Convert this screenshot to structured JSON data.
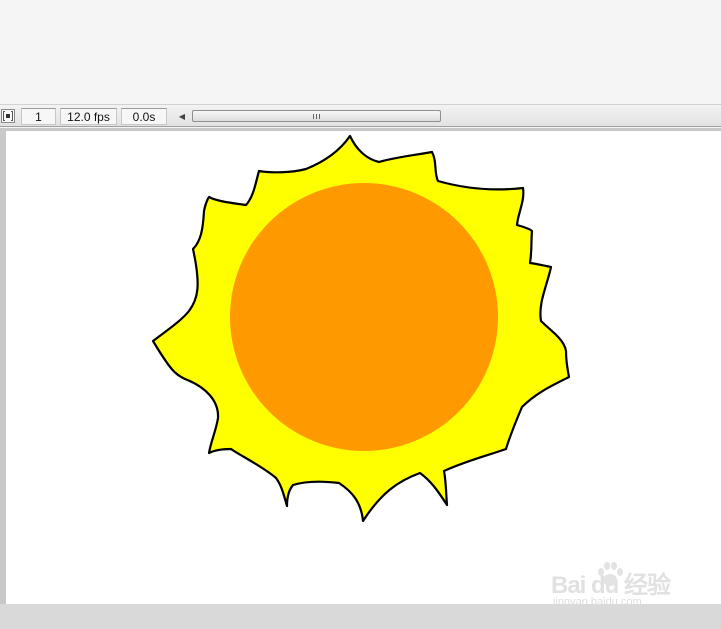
{
  "timeline": {
    "frame_number": "1",
    "frame_rate": "12.0 fps",
    "elapsed_time": "0.0s",
    "center_frame_icon": "center-frame-icon",
    "scroll_left_icon": "scroll-left-arrow-icon",
    "grip_icon": "scrollbar-grip-icon"
  },
  "stage": {
    "background": "#ffffff",
    "drawing": {
      "subject": "sun",
      "rays_fill": "#ffff00",
      "rays_stroke": "#000000",
      "core_fill": "#ff9900"
    }
  },
  "watermark": {
    "logo": "Bai du 经验",
    "url": "jingyan.baidu.com"
  },
  "colors": {
    "panel": "#f4f4f4",
    "stage_border": "#c8c8c8",
    "bottom_strip": "#d9d9d9"
  }
}
